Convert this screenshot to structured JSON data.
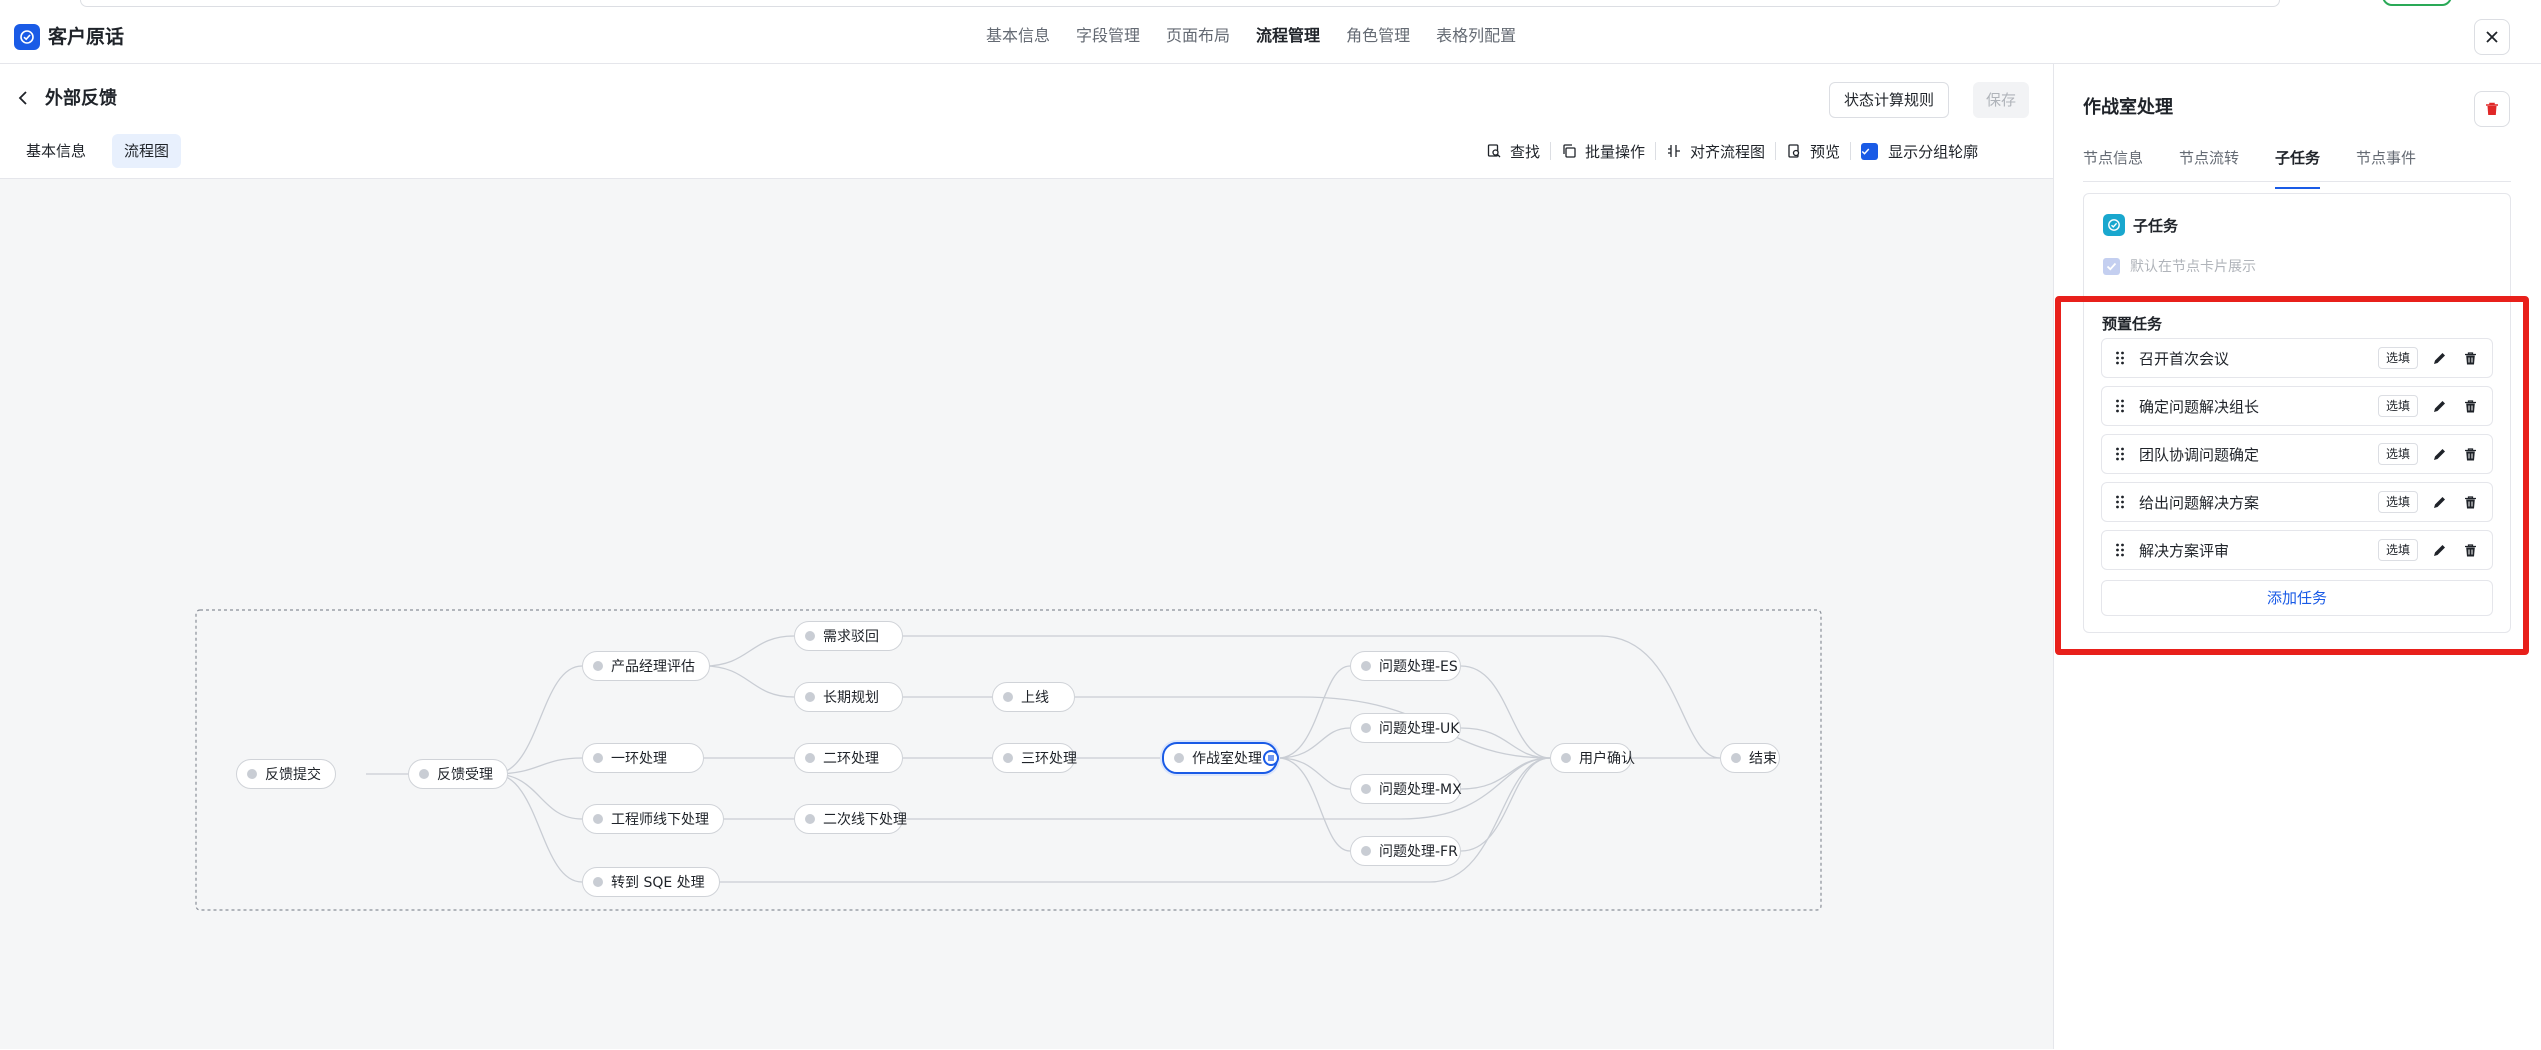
{
  "app": {
    "title": "客户原话"
  },
  "topnav": [
    {
      "label": "基本信息",
      "active": false
    },
    {
      "label": "字段管理",
      "active": false
    },
    {
      "label": "页面布局",
      "active": false
    },
    {
      "label": "流程管理",
      "active": true
    },
    {
      "label": "角色管理",
      "active": false
    },
    {
      "label": "表格列配置",
      "active": false
    }
  ],
  "page": {
    "title": "外部反馈"
  },
  "actions": {
    "state_rules": "状态计算规则",
    "save": "保存"
  },
  "subtabs": [
    {
      "label": "基本信息",
      "active": false
    },
    {
      "label": "流程图",
      "active": true
    }
  ],
  "toolbar": {
    "find": "查找",
    "batch": "批量操作",
    "align": "对齐流程图",
    "preview": "预览",
    "show_outline": "显示分组轮廓",
    "show_outline_checked": true
  },
  "flow": {
    "nodes": {
      "submit": "反馈提交",
      "accept": "反馈受理",
      "pm_eval": "产品经理评估",
      "first": "一环处理",
      "engineer": "工程师线下处理",
      "sqe": "转到 SQE 处理",
      "reject": "需求驳回",
      "long_term": "长期规划",
      "second": "二环处理",
      "second_offline": "二次线下处理",
      "online": "上线",
      "third": "三环处理",
      "war_room": "作战室处理",
      "es": "问题处理-ES",
      "uk": "问题处理-UK",
      "mx": "问题处理-MX",
      "fr": "问题处理-FR",
      "confirm": "用户确认",
      "end": "结束"
    },
    "selected": "war_room"
  },
  "panel": {
    "title": "作战室处理",
    "tabs": [
      {
        "label": "节点信息",
        "active": false
      },
      {
        "label": "节点流转",
        "active": false
      },
      {
        "label": "子任务",
        "active": true
      },
      {
        "label": "节点事件",
        "active": false
      }
    ],
    "subtask_label": "子任务",
    "default_show": "默认在节点卡片展示",
    "preset_label": "预置任务",
    "tasks": [
      {
        "name": "召开首次会议",
        "tag": "选填"
      },
      {
        "name": "确定问题解决组长",
        "tag": "选填"
      },
      {
        "name": "团队协调问题确定",
        "tag": "选填"
      },
      {
        "name": "给出问题解决方案",
        "tag": "选填"
      },
      {
        "name": "解决方案评审",
        "tag": "选填"
      }
    ],
    "add_task": "添加任务"
  },
  "colors": {
    "accent": "#1a5be6",
    "highlight": "#e8201b",
    "danger": "#e02828"
  }
}
